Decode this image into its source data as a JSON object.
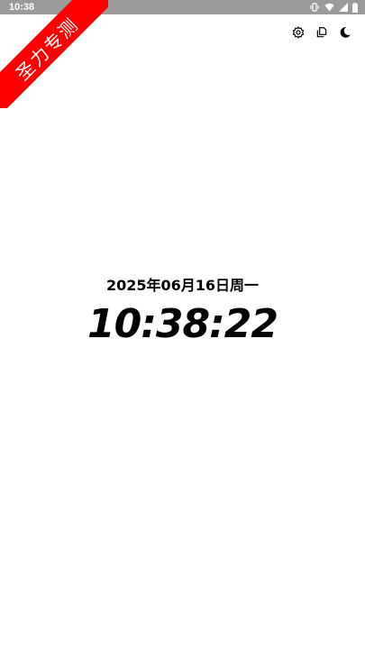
{
  "status_bar": {
    "time": "10:38",
    "icons": [
      "vibrate-icon",
      "wifi-icon",
      "signal-icon",
      "battery-icon"
    ]
  },
  "ribbon": {
    "text": "圣力专测",
    "color": "#ff0000"
  },
  "toolbar": {
    "items": [
      {
        "icon": "settings-icon"
      },
      {
        "icon": "copy-icon"
      },
      {
        "icon": "dark-mode-icon"
      }
    ]
  },
  "clock": {
    "date": "2025年06月16日周一",
    "time": "10:38:22"
  }
}
